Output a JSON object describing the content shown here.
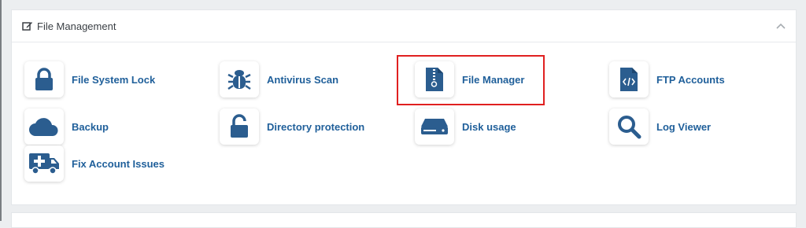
{
  "panel": {
    "title": "File Management",
    "header_icon": "edit-icon",
    "collapse_icon": "chevron-up-icon"
  },
  "tools": [
    {
      "label": "File System Lock",
      "icon": "lock-icon"
    },
    {
      "label": "Antivirus Scan",
      "icon": "bug-icon"
    },
    {
      "label": "File Manager",
      "icon": "zip-file-icon"
    },
    {
      "label": "FTP Accounts",
      "icon": "code-file-icon"
    },
    {
      "label": "Backup",
      "icon": "cloud-icon"
    },
    {
      "label": "Directory protection",
      "icon": "unlock-icon"
    },
    {
      "label": "Disk usage",
      "icon": "hard-drive-icon"
    },
    {
      "label": "Log Viewer",
      "icon": "search-icon"
    },
    {
      "label": "Fix Account Issues",
      "icon": "ambulance-icon"
    }
  ],
  "colors": {
    "icon_blue": "#2b5d8f",
    "label_blue": "#1f5f9a",
    "highlight_red": "#e02020"
  }
}
